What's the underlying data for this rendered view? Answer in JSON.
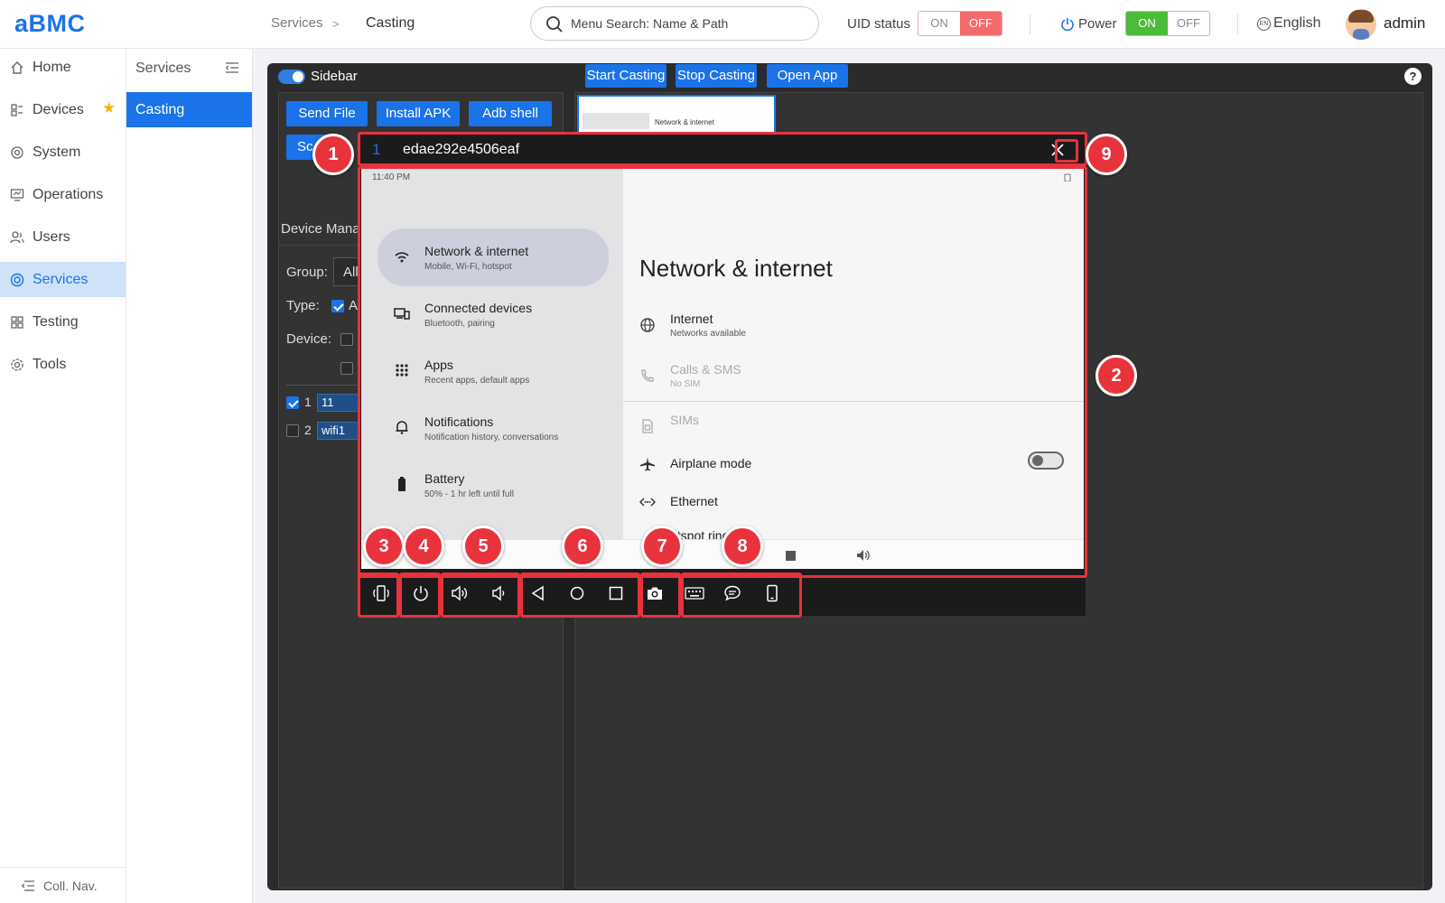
{
  "app": {
    "logo": "aBMC"
  },
  "header": {
    "breadcrumb": [
      "Services",
      "Casting"
    ],
    "breadcrumb_sep": ">",
    "search_placeholder": "Menu Search: Name & Path",
    "uid_status": {
      "label": "UID status",
      "on": "ON",
      "off": "OFF",
      "selected": "OFF"
    },
    "power": {
      "label": "Power",
      "on": "ON",
      "off": "OFF",
      "selected": "ON"
    },
    "language": "English",
    "user": "admin"
  },
  "sidebar": {
    "items": [
      {
        "label": "Home",
        "icon": "home-icon"
      },
      {
        "label": "Devices",
        "icon": "devices-icon",
        "starred": true
      },
      {
        "label": "System",
        "icon": "system-icon"
      },
      {
        "label": "Operations",
        "icon": "operations-icon"
      },
      {
        "label": "Users",
        "icon": "users-icon"
      },
      {
        "label": "Services",
        "icon": "services-icon",
        "active": true
      },
      {
        "label": "Testing",
        "icon": "testing-icon"
      },
      {
        "label": "Tools",
        "icon": "tools-icon"
      }
    ],
    "collapse_label": "Coll. Nav."
  },
  "subnav": {
    "title": "Services",
    "active_item": "Casting"
  },
  "panel": {
    "sidebar_toggle_label": "Sidebar",
    "buttons": [
      "Start Casting",
      "Stop Casting",
      "Open App"
    ],
    "help": "?",
    "left": {
      "actions": [
        "Send File",
        "Install APK",
        "Adb shell",
        "Sc"
      ],
      "device_manager_label": "Device Mana",
      "group_label": "Group:",
      "group_value": "All",
      "type_label": "Type:",
      "type_value": "A",
      "device_label": "Device:",
      "rows": [
        {
          "index": "1",
          "name": "11",
          "checked": true
        },
        {
          "index": "2",
          "name": "wifi1",
          "checked": false
        }
      ]
    },
    "thumbnail_text": "Network & internet"
  },
  "cast_window": {
    "index": "1",
    "device_id": "edae292e4506eaf",
    "screen": {
      "status_time": "11:40 PM",
      "left_items": [
        {
          "title": "Network & internet",
          "subtitle": "Mobile, Wi-Fi, hotspot",
          "icon": "wifi-icon",
          "selected": true
        },
        {
          "title": "Connected devices",
          "subtitle": "Bluetooth, pairing",
          "icon": "connected-devices-icon"
        },
        {
          "title": "Apps",
          "subtitle": "Recent apps, default apps",
          "icon": "apps-grid-icon"
        },
        {
          "title": "Notifications",
          "subtitle": "Notification history, conversations",
          "icon": "bell-icon"
        },
        {
          "title": "Battery",
          "subtitle": "50% - 1 hr left until full",
          "icon": "battery-icon"
        }
      ],
      "page_title": "Network & internet",
      "right_items": [
        {
          "title": "Internet",
          "subtitle": "Networks available",
          "icon": "globe-icon",
          "dim": false
        },
        {
          "title": "Calls & SMS",
          "subtitle": "No SIM",
          "icon": "calls-icon",
          "dim": true
        },
        {
          "title": "SIMs",
          "subtitle": "",
          "icon": "sim-icon",
          "dim": true
        },
        {
          "title": "Airplane mode",
          "subtitle": "",
          "icon": "airplane-icon",
          "dim": false,
          "toggle": "off"
        },
        {
          "title": "Ethernet",
          "subtitle": "",
          "icon": "ethernet-icon",
          "dim": false
        },
        {
          "title": "otspot   ring",
          "subtitle": "",
          "icon": "hotspot-icon",
          "dim": false
        }
      ]
    },
    "toolbar": [
      "rotate-icon",
      "power-icon",
      "volume-up-icon",
      "volume-down-icon",
      "back-icon",
      "home-circle-icon",
      "recents-icon",
      "camera-icon",
      "keyboard-icon",
      "chat-icon",
      "phone-icon"
    ]
  },
  "callouts": [
    "1",
    "2",
    "3",
    "4",
    "5",
    "6",
    "7",
    "8",
    "9"
  ],
  "colors": {
    "accent": "#1a73e8",
    "callout": "#e8323c",
    "power_on": "#4cbb3a",
    "uid_off": "#f46a6a"
  }
}
